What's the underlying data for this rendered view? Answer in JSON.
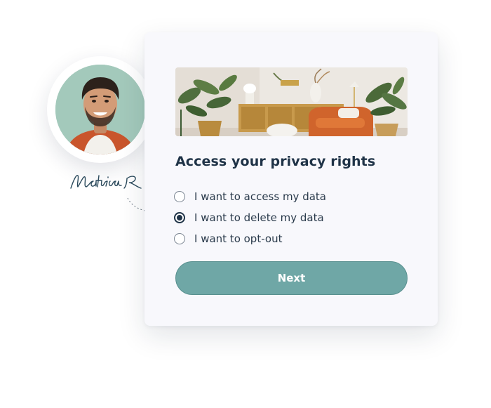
{
  "profile": {
    "name_signature": "Mathias R",
    "avatar_icon": "person-avatar"
  },
  "form": {
    "hero_image": "living-room-photo",
    "title": "Access your privacy rights",
    "options": [
      {
        "label": "I want to access my data",
        "selected": false
      },
      {
        "label": "I want to delete my data",
        "selected": true
      },
      {
        "label": "I want to opt-out",
        "selected": false
      }
    ],
    "next_label": "Next"
  },
  "colors": {
    "accent": "#6fa7a6",
    "heading": "#1f3347",
    "card_background": "#f8f8fc"
  }
}
